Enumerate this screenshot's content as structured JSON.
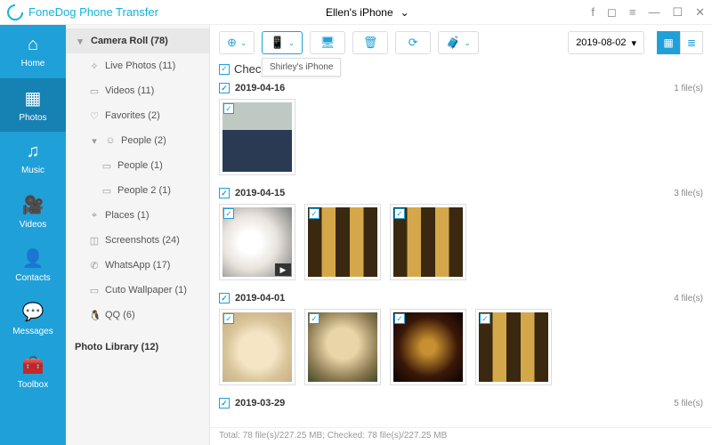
{
  "app_name": "FoneDog Phone Transfer",
  "device": {
    "name": "Ellen's iPhone"
  },
  "tooltip": "Shirley's iPhone",
  "nav": [
    {
      "icon": "⌂",
      "label": "Home"
    },
    {
      "icon": "▦",
      "label": "Photos"
    },
    {
      "icon": "♫",
      "label": "Music"
    },
    {
      "icon": "🎥",
      "label": "Videos"
    },
    {
      "icon": "👤",
      "label": "Contacts"
    },
    {
      "icon": "💬",
      "label": "Messages"
    },
    {
      "icon": "🧰",
      "label": "Toolbox"
    }
  ],
  "sidebar": {
    "root": "Camera Roll (78)",
    "items": [
      {
        "icon": "✧",
        "label": "Live Photos (11)"
      },
      {
        "icon": "▭",
        "label": "Videos (11)"
      },
      {
        "icon": "♡",
        "label": "Favorites (2)"
      }
    ],
    "people_root": "People (2)",
    "people": [
      {
        "icon": "▭",
        "label": "People (1)"
      },
      {
        "icon": "▭",
        "label": "People 2 (1)"
      }
    ],
    "items2": [
      {
        "icon": "⌖",
        "label": "Places (1)"
      },
      {
        "icon": "◫",
        "label": "Screenshots (24)"
      },
      {
        "icon": "✆",
        "label": "WhatsApp (17)"
      },
      {
        "icon": "▭",
        "label": "Cuto Wallpaper (1)"
      },
      {
        "icon": "🐧",
        "label": "QQ (6)"
      }
    ],
    "library": "Photo Library (12)"
  },
  "toolbar": {
    "date": "2019-08-02"
  },
  "check_all": "Check All(78)",
  "groups": [
    {
      "date": "2019-04-16",
      "count": "1 file(s)",
      "thumbs": [
        "p-phone"
      ]
    },
    {
      "date": "2019-04-15",
      "count": "3 file(s)",
      "thumbs": [
        "p-cup",
        "p-beer",
        "p-beer"
      ],
      "video_idx": 0
    },
    {
      "date": "2019-04-01",
      "count": "4 file(s)",
      "thumbs": [
        "p-dog1",
        "p-dog2",
        "p-dark",
        "p-beer"
      ]
    },
    {
      "date": "2019-03-29",
      "count": "5 file(s)",
      "thumbs": []
    }
  ],
  "status": "Total: 78 file(s)/227.25 MB; Checked: 78 file(s)/227.25 MB"
}
